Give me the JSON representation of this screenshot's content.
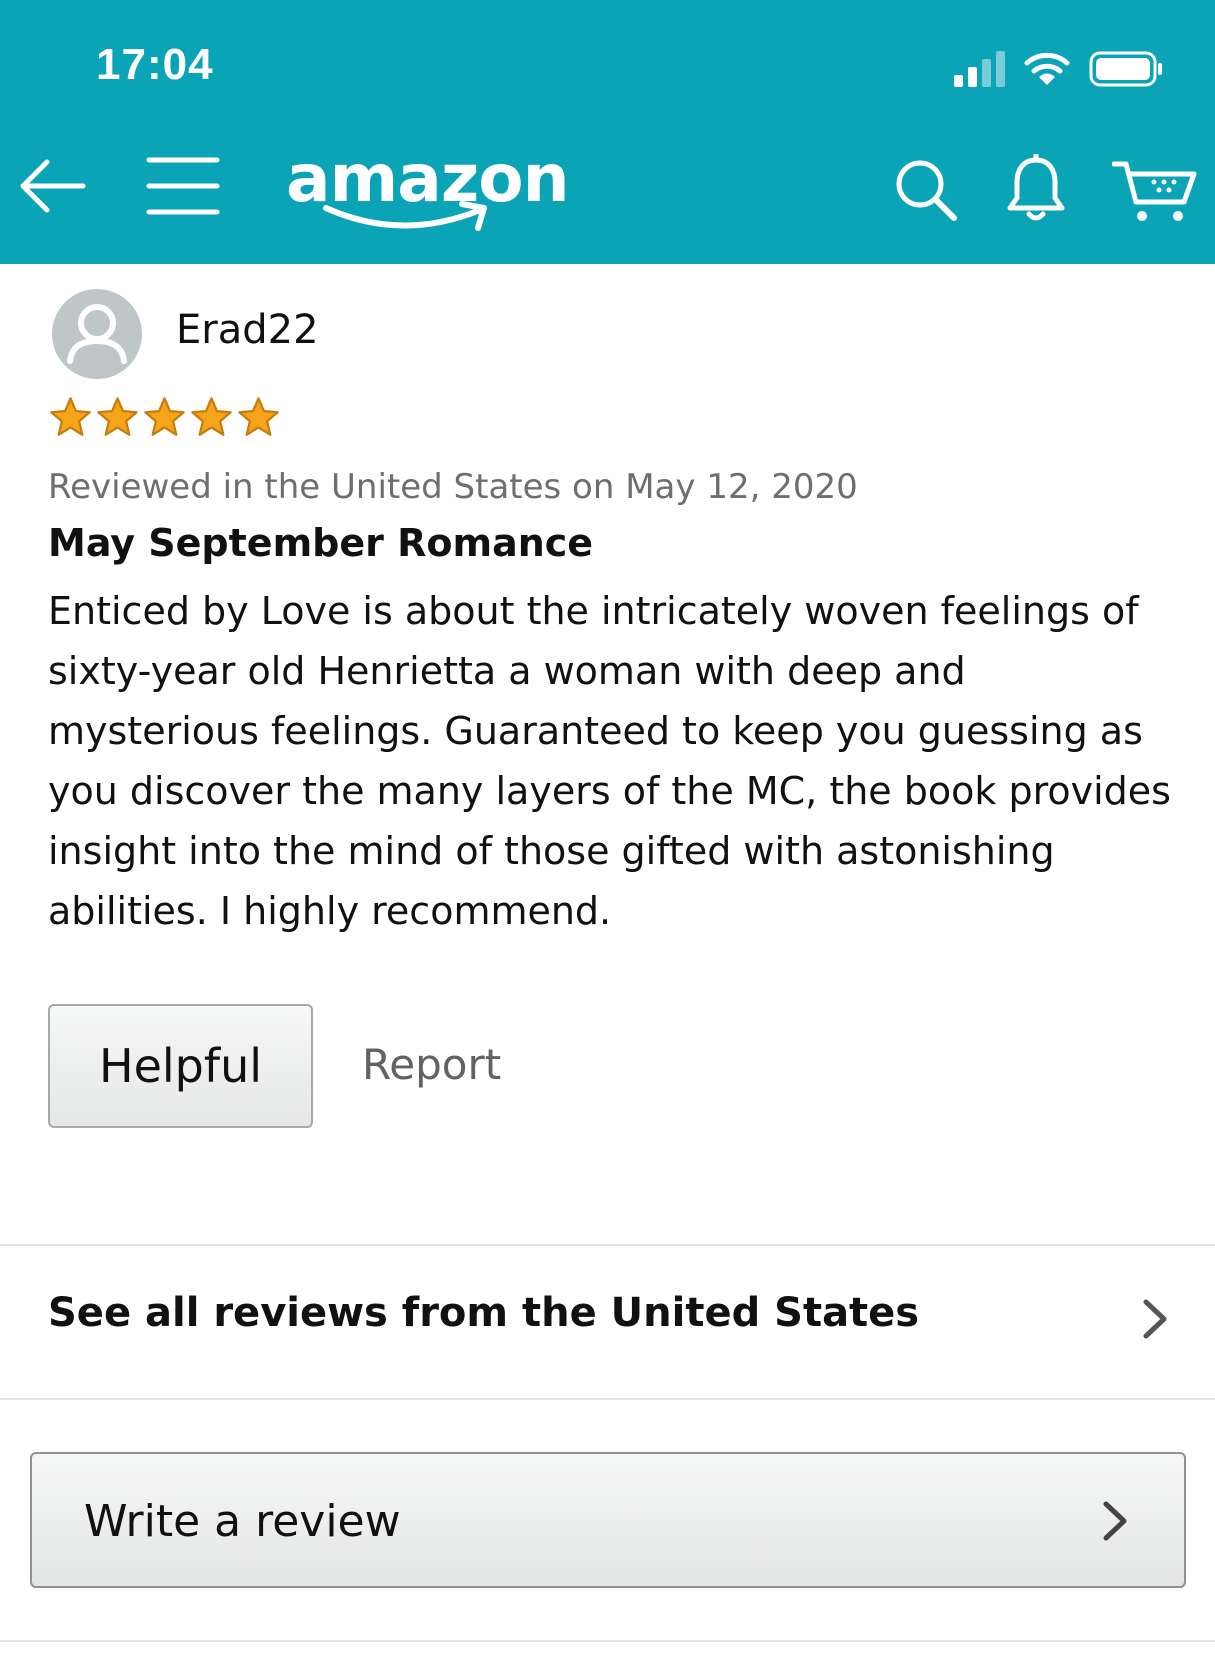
{
  "status_bar": {
    "time": "17:04",
    "icons": [
      "cellular-signal-icon",
      "wifi-icon",
      "battery-icon"
    ]
  },
  "header": {
    "logo_text": "amazon",
    "icons": [
      "back-arrow-icon",
      "menu-icon",
      "search-icon",
      "bell-icon",
      "cart-icon"
    ],
    "colors": {
      "background": "#0aa4b6",
      "foreground": "#ffffff"
    }
  },
  "review": {
    "reviewer_name": "Erad22",
    "rating": 5,
    "rating_max": 5,
    "meta": "Reviewed in the United States on May 12, 2020",
    "title": "May September Romance",
    "body": "Enticed by Love is about the intricately woven feelings of sixty-year old Henrietta a woman with deep and mysterious feelings. Guaranteed to keep you guessing as you discover the many layers of the MC, the book provides insight into the mind of those gifted with astonishing abilities. I highly recommend.",
    "helpful_label": "Helpful",
    "report_label": "Report",
    "colors": {
      "star": "#f6a41c",
      "meta": "#6b6f70"
    }
  },
  "see_all": {
    "label": "See all reviews from the United States"
  },
  "write_review": {
    "label": "Write a review"
  }
}
